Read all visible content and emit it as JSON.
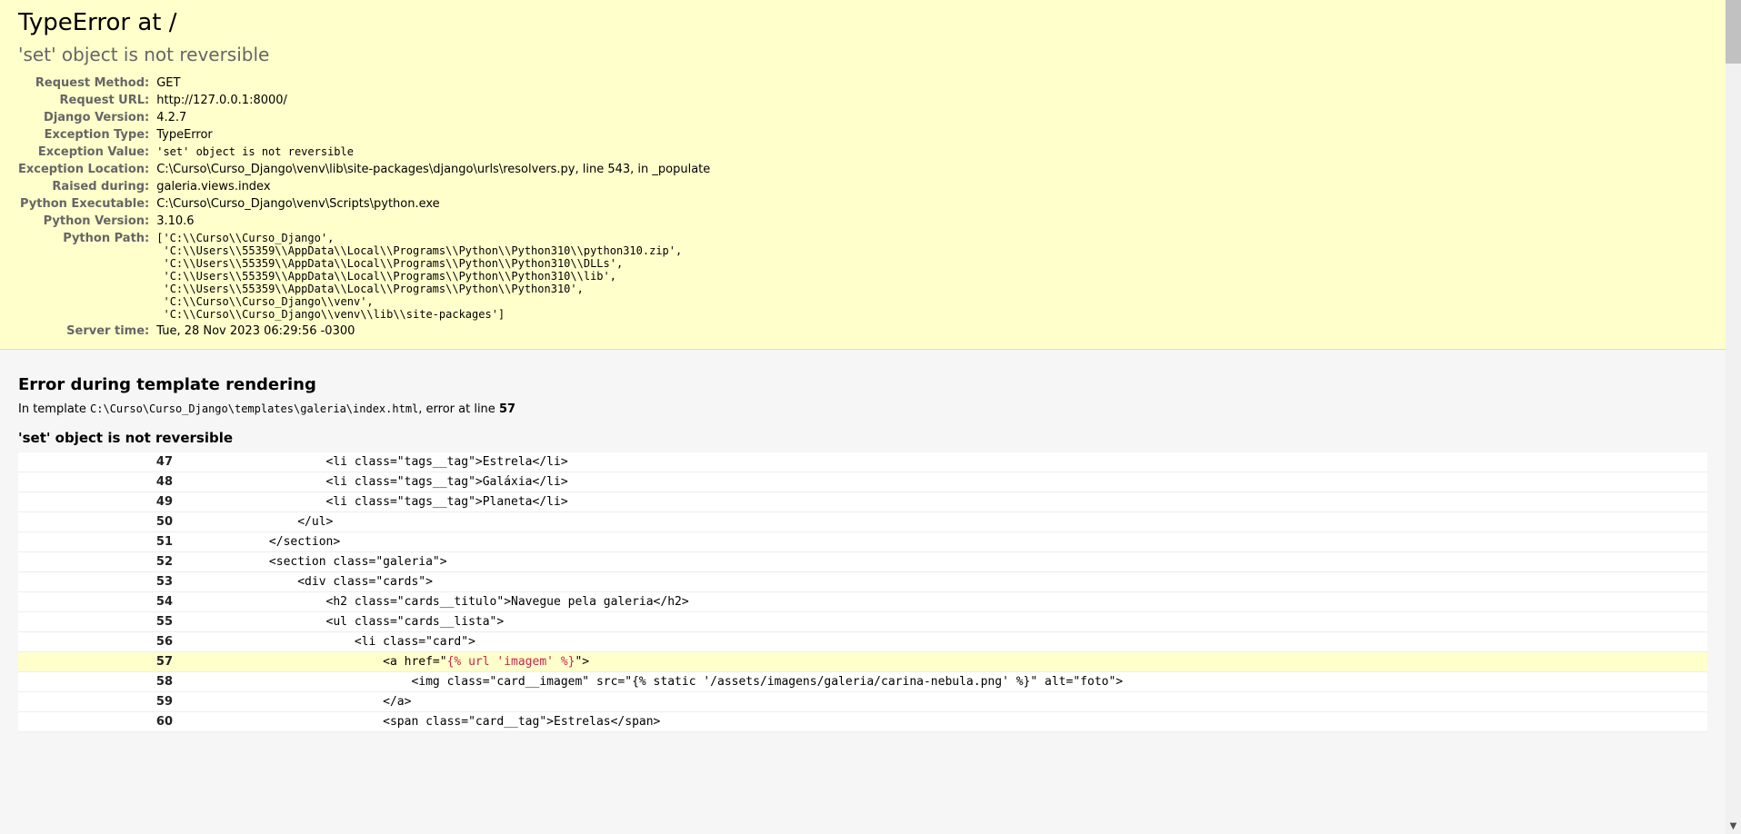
{
  "header": {
    "exc_type": "TypeError",
    "at_word": "at",
    "request_path": "/",
    "exc_message": "'set' object is not reversible"
  },
  "meta": [
    {
      "label": "Request Method:",
      "value": "GET"
    },
    {
      "label": "Request URL:",
      "value": "http://127.0.0.1:8000/"
    },
    {
      "label": "Django Version:",
      "value": "4.2.7"
    },
    {
      "label": "Exception Type:",
      "value": "TypeError"
    },
    {
      "label": "Exception Value:",
      "value": "'set' object is not reversible",
      "mono": true
    },
    {
      "label": "Exception Location:",
      "value": "C:\\Curso\\Curso_Django\\venv\\lib\\site-packages\\django\\urls\\resolvers.py, line 543, in _populate"
    },
    {
      "label": "Raised during:",
      "value": "galeria.views.index"
    },
    {
      "label": "Python Executable:",
      "value": "C:\\Curso\\Curso_Django\\venv\\Scripts\\python.exe"
    },
    {
      "label": "Python Version:",
      "value": "3.10.6"
    },
    {
      "label": "Python Path:",
      "value": "['C:\\\\Curso\\\\Curso_Django',\n 'C:\\\\Users\\\\55359\\\\AppData\\\\Local\\\\Programs\\\\Python\\\\Python310\\\\python310.zip',\n 'C:\\\\Users\\\\55359\\\\AppData\\\\Local\\\\Programs\\\\Python\\\\Python310\\\\DLLs',\n 'C:\\\\Users\\\\55359\\\\AppData\\\\Local\\\\Programs\\\\Python\\\\Python310\\\\lib',\n 'C:\\\\Users\\\\55359\\\\AppData\\\\Local\\\\Programs\\\\Python\\\\Python310',\n 'C:\\\\Curso\\\\Curso_Django\\\\venv',\n 'C:\\\\Curso\\\\Curso_Django\\\\venv\\\\lib\\\\site-packages']",
      "mono": true
    },
    {
      "label": "Server time:",
      "value": "Tue, 28 Nov 2023 06:29:56 -0300"
    }
  ],
  "template": {
    "heading": "Error during template rendering",
    "prefix": "In template ",
    "path": "C:\\Curso\\Curso_Django\\templates\\galeria\\index.html",
    "middle": ", error at line ",
    "lineno": "57",
    "error_msg": "'set' object is not reversible",
    "lines": [
      {
        "n": "47",
        "code": "                    <li class=\"tags__tag\">Estrela</li>"
      },
      {
        "n": "48",
        "code": "                    <li class=\"tags__tag\">Galáxia</li>"
      },
      {
        "n": "49",
        "code": "                    <li class=\"tags__tag\">Planeta</li>"
      },
      {
        "n": "50",
        "code": "                </ul>"
      },
      {
        "n": "51",
        "code": "            </section>"
      },
      {
        "n": "52",
        "code": "            <section class=\"galeria\">"
      },
      {
        "n": "53",
        "code": "                <div class=\"cards\">"
      },
      {
        "n": "54",
        "code": "                    <h2 class=\"cards__titulo\">Navegue pela galeria</h2>"
      },
      {
        "n": "55",
        "code": "                    <ul class=\"cards__lista\">"
      },
      {
        "n": "56",
        "code": "                        <li class=\"card\">"
      },
      {
        "n": "57",
        "pre": "                            <a href=\"",
        "hl": "{% url 'imagem' %}",
        "post": "\">",
        "error": true
      },
      {
        "n": "58",
        "code": "                                <img class=\"card__imagem\" src=\"{% static '/assets/imagens/galeria/carina-nebula.png' %}\" alt=\"foto\">"
      },
      {
        "n": "59",
        "code": "                            </a>"
      },
      {
        "n": "60",
        "code": "                            <span class=\"card__tag\">Estrelas</span>"
      }
    ]
  }
}
